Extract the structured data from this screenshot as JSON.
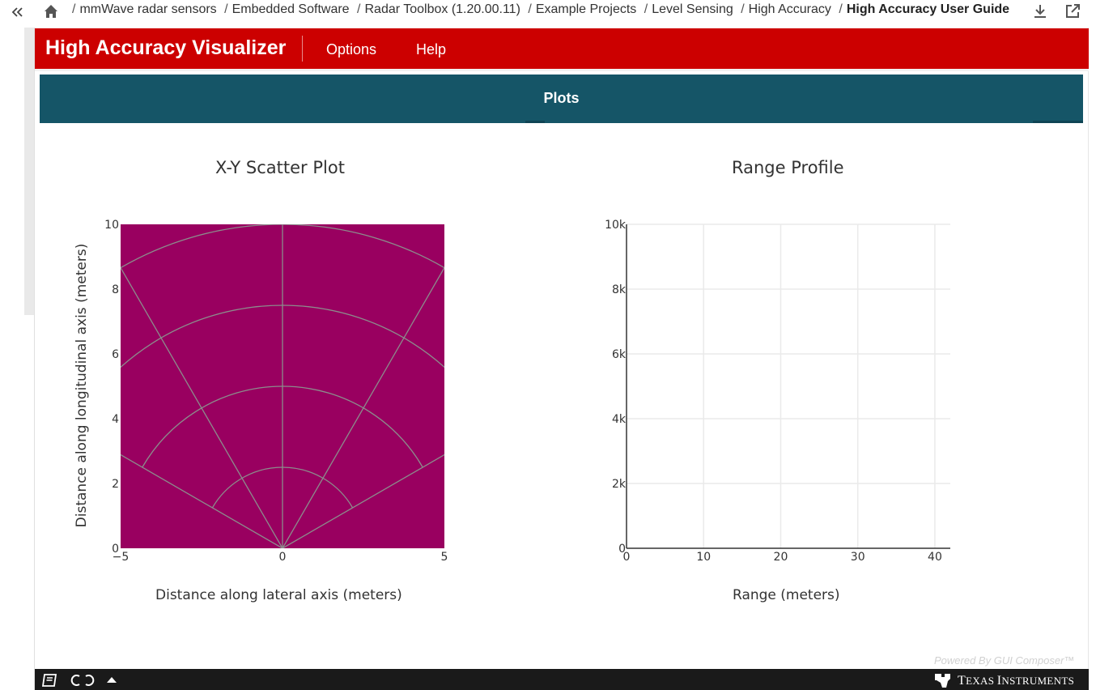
{
  "breadcrumb": {
    "items": [
      "mmWave radar sensors",
      "Embedded Software",
      "Radar Toolbox (1.20.00.11)",
      "Example Projects",
      "Level Sensing",
      "High Accuracy",
      "High Accuracy User Guide"
    ],
    "separator": "/"
  },
  "app": {
    "title": "High Accuracy Visualizer",
    "menu": [
      "Options",
      "Help"
    ],
    "brand_color": "#cc0000"
  },
  "tabs": {
    "items": [
      "Plots"
    ],
    "active": "Plots",
    "color": "#155567"
  },
  "icons": {
    "collapse": "double-chevron-left-icon",
    "home": "home-icon",
    "download": "download-icon",
    "open_external": "open-in-new-icon",
    "footer_book": "book-icon",
    "footer_connection": "connection-icon",
    "footer_expand": "caret-up-icon",
    "ti_logo": "texas-instruments-logo"
  },
  "chart_data": [
    {
      "type": "scatter",
      "title": "X-Y Scatter Plot",
      "xlabel": "Distance along lateral axis (meters)",
      "ylabel": "Distance along longitudinal axis (meters)",
      "xlim": [
        -5,
        5
      ],
      "ylim": [
        0,
        10
      ],
      "xticks": [
        "−5",
        "0",
        "5"
      ],
      "yticks": [
        "0",
        "2",
        "4",
        "6",
        "8",
        "10"
      ],
      "background_color": "#990060",
      "grid": "polar",
      "polar_ranges": [
        2.5,
        5,
        7.5,
        10
      ],
      "polar_angles_deg": [
        -60,
        -30,
        0,
        30,
        60
      ],
      "points": []
    },
    {
      "type": "line",
      "title": "Range Profile",
      "xlabel": "Range (meters)",
      "ylabel": "",
      "xlim": [
        0,
        42
      ],
      "ylim": [
        0,
        10000
      ],
      "xticks": [
        "0",
        "10",
        "20",
        "30",
        "40"
      ],
      "yticks": [
        "0",
        "2k",
        "4k",
        "6k",
        "8k",
        "10k"
      ],
      "grid": true,
      "series": []
    }
  ],
  "footer": {
    "powered_by": "Powered By GUI Composer™",
    "brand_prefix": "T",
    "brand_word1": "EXAS ",
    "brand_initial2": "I",
    "brand_word2": "NSTRUMENTS"
  }
}
